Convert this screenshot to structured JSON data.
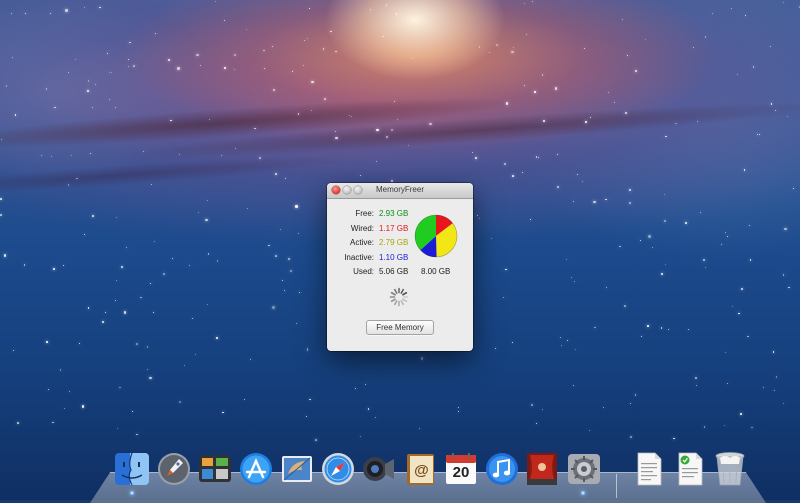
{
  "window": {
    "title": "MemoryFreer",
    "free_button_label": "Free Memory"
  },
  "stats": [
    {
      "label": "Free:",
      "value": "2.93 GB",
      "color": "#0b8f16"
    },
    {
      "label": "Wired:",
      "value": "1.17 GB",
      "color": "#e01b1b"
    },
    {
      "label": "Active:",
      "value": "2.79 GB",
      "color": "#a8a800"
    },
    {
      "label": "Inactive:",
      "value": "1.10 GB",
      "color": "#2020d8"
    },
    {
      "label": "Used:",
      "value": "5.06 GB",
      "color": "#222222"
    }
  ],
  "total": "8.00 GB",
  "pie_chart": {
    "slices": [
      {
        "name": "Wired",
        "value": 1.17,
        "color": "#e8161c"
      },
      {
        "name": "Active",
        "value": 2.79,
        "color": "#f2e616"
      },
      {
        "name": "Inactive",
        "value": 1.1,
        "color": "#1c1cd6"
      },
      {
        "name": "Free",
        "value": 2.93,
        "color": "#21cc21"
      }
    ]
  },
  "dock": {
    "items": [
      {
        "name": "finder-icon"
      },
      {
        "name": "launchpad-icon"
      },
      {
        "name": "mission-control-icon"
      },
      {
        "name": "app-store-icon"
      },
      {
        "name": "mail-icon"
      },
      {
        "name": "safari-icon"
      },
      {
        "name": "facetime-icon"
      },
      {
        "name": "address-book-icon"
      },
      {
        "name": "calendar-icon",
        "day": "20"
      },
      {
        "name": "itunes-icon"
      },
      {
        "name": "photo-booth-icon"
      },
      {
        "name": "system-preferences-icon"
      },
      {
        "name": "document-icon"
      },
      {
        "name": "document-checked-icon"
      },
      {
        "name": "trash-icon"
      }
    ]
  }
}
